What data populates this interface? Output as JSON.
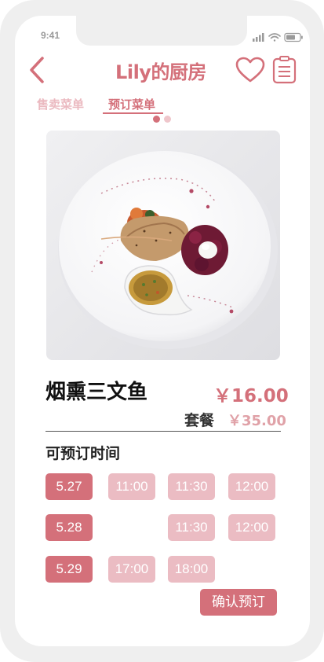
{
  "status_bar": {
    "time": "9:41"
  },
  "header": {
    "title": "Lily的厨房"
  },
  "tabs": [
    {
      "label": "售卖菜单",
      "active": false
    },
    {
      "label": "预订菜单",
      "active": true
    }
  ],
  "pager": {
    "page_count": 2,
    "current": 1
  },
  "dish": {
    "name": "烟熏三文鱼",
    "price": "￥16.00",
    "combo_label": "套餐",
    "combo_price": "￥35.00"
  },
  "booking": {
    "section_title": "可预订时间",
    "rows": [
      {
        "date": "5.27",
        "slots": [
          "11:00",
          "11:30",
          "12:00"
        ]
      },
      {
        "date": "5.28",
        "slots": [
          "",
          "11:30",
          "12:00"
        ]
      },
      {
        "date": "5.29",
        "slots": [
          "17:00",
          "18:00",
          ""
        ]
      }
    ],
    "confirm_label": "确认预订"
  },
  "icons": {
    "back": "chevron-left-icon",
    "favorite": "heart-icon",
    "orders": "clipboard-icon"
  },
  "colors": {
    "accent": "#d4707a",
    "accent_light": "#ebbcc3",
    "tab_inactive": "#ebb9c0"
  }
}
